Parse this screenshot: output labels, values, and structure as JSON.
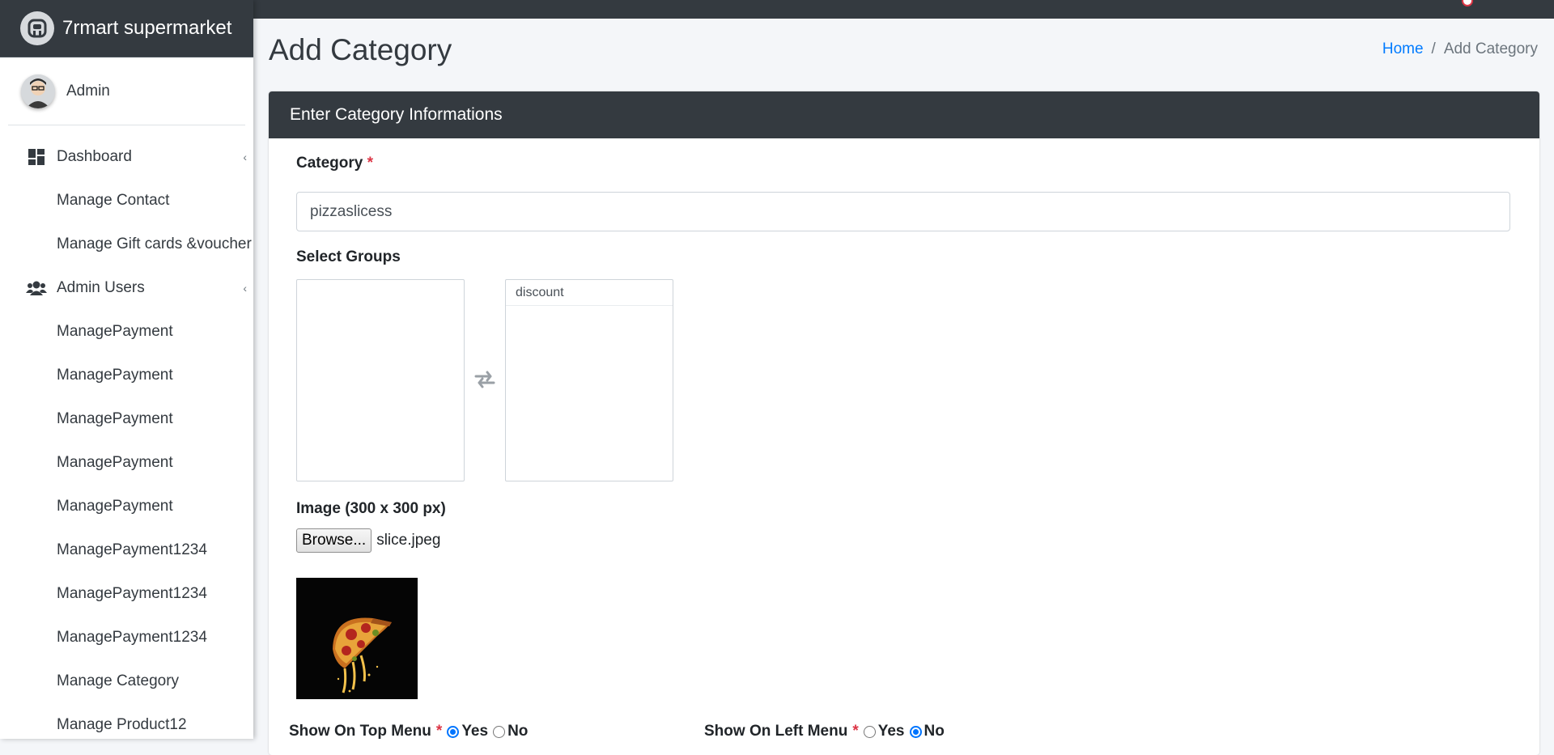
{
  "brand": {
    "name": "7rmart supermarket",
    "logo_icon": "app-logo-icon"
  },
  "user": {
    "name": "Admin",
    "avatar_icon": "user-avatar"
  },
  "sidebar": {
    "items": [
      {
        "label": "Dashboard",
        "icon": "dashboard-grid-icon"
      },
      {
        "label": "Manage Contact"
      },
      {
        "label": "Manage Gift cards &voucher"
      },
      {
        "label": "Admin Users",
        "icon": "users-icon"
      },
      {
        "label": "ManagePayment"
      },
      {
        "label": "ManagePayment"
      },
      {
        "label": "ManagePayment"
      },
      {
        "label": "ManagePayment"
      },
      {
        "label": "ManagePayment"
      },
      {
        "label": "ManagePayment1234"
      },
      {
        "label": "ManagePayment1234"
      },
      {
        "label": "ManagePayment1234"
      },
      {
        "label": "Manage Category"
      },
      {
        "label": "Manage Product12"
      }
    ]
  },
  "page": {
    "title": "Add Category",
    "breadcrumb": {
      "home": "Home",
      "separator": "/",
      "current": "Add Category"
    }
  },
  "form": {
    "header": "Enter Category Informations",
    "category_label": "Category",
    "required_mark": "*",
    "category_value": "pizzaslicess",
    "groups_label": "Select Groups",
    "groups_available": [],
    "groups_selected": [
      "discount"
    ],
    "image_label": "Image (300 x 300 px)",
    "browse_label": "Browse...",
    "file_name": "slice.jpeg",
    "top_menu_label": "Show On Top Menu",
    "left_menu_label": "Show On Left Menu",
    "yes_label": "Yes",
    "no_label": "No",
    "top_menu_value": "Yes",
    "left_menu_value": "No"
  },
  "colors": {
    "dark": "#343a40",
    "link": "#007bff",
    "required": "#dc3545",
    "radio_checked": "#0075ff"
  }
}
